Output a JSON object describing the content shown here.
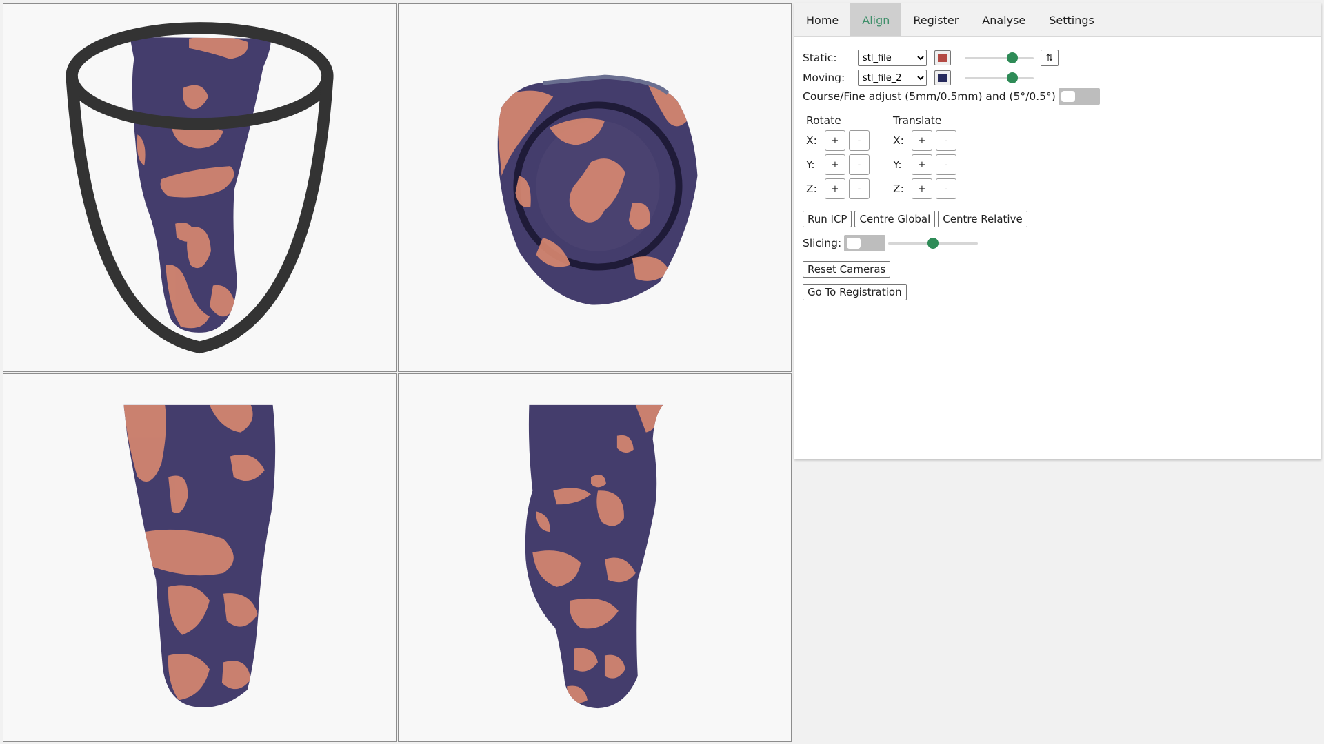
{
  "tabs": [
    {
      "label": "Home"
    },
    {
      "label": "Align"
    },
    {
      "label": "Register"
    },
    {
      "label": "Analyse"
    },
    {
      "label": "Settings"
    }
  ],
  "active_tab": "Align",
  "align": {
    "static_label": "Static:",
    "static_file": "stl_file",
    "static_color": "#b34a44",
    "static_opacity_pct": 73,
    "moving_label": "Moving:",
    "moving_file": "stl_file_2",
    "moving_color": "#262a5c",
    "moving_opacity_pct": 73,
    "swap_icon": "swap-vertical-icon",
    "coarse_fine_label": "Course/Fine adjust (5mm/0.5mm) and (5°/0.5°)",
    "coarse_fine_on": false,
    "rotate_label": "Rotate",
    "translate_label": "Translate",
    "axes": [
      "X:",
      "Y:",
      "Z:"
    ],
    "plus": "+",
    "minus": "-",
    "run_icp": "Run ICP",
    "centre_global": "Centre Global",
    "centre_relative": "Centre Relative",
    "slicing_label": "Slicing:",
    "slicing_on": false,
    "slicing_level_pct": 50,
    "reset_cameras": "Reset Cameras",
    "go_to_registration": "Go To Registration"
  },
  "viewports": [
    {
      "name": "viewport-front"
    },
    {
      "name": "viewport-top"
    },
    {
      "name": "viewport-side-left"
    },
    {
      "name": "viewport-side-right"
    }
  ],
  "colors": {
    "static_mesh": "#d98870",
    "moving_mesh": "#443d6c",
    "accent": "#2e8b57"
  }
}
